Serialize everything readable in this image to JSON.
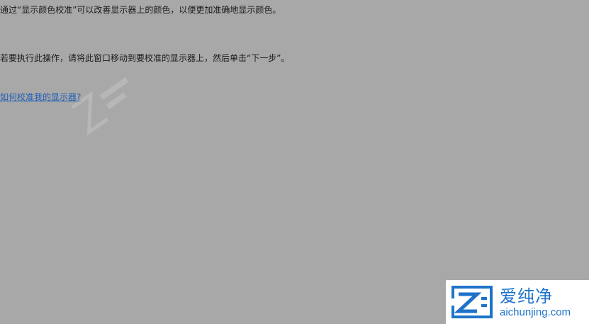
{
  "content": {
    "intro_text": "通过“显示颜色校准”可以改善显示器上的颜色，以便更加准确地显示颜色。",
    "instruction_text": "若要执行此操作，请将此窗口移动到要校准的显示器上，然后单击“下一步”。",
    "help_link": "如何校准我的显示器?"
  },
  "logo": {
    "name_cn": "爱纯净",
    "site": "aichunjing.com",
    "color": "#1e73c9"
  },
  "colors": {
    "background": "#a8a8a8",
    "link": "#1f5fb8"
  }
}
